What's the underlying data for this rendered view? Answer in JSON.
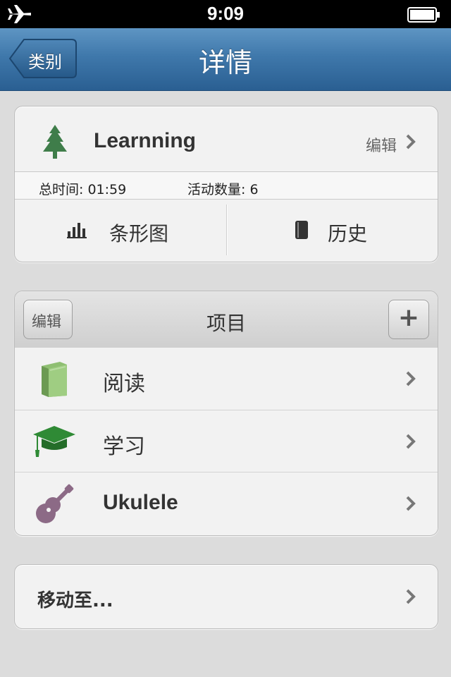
{
  "status_bar": {
    "time": "9:09",
    "left_icon": "airplane-icon",
    "right_icon": "battery-icon"
  },
  "nav": {
    "back_label": "类别",
    "title": "详情"
  },
  "category_card": {
    "name": "Learnning",
    "icon": "tree-icon",
    "edit_label": "编辑",
    "total_time_label": "总时间: 01:59",
    "activity_count_label": "活动数量: 6",
    "tabs": [
      {
        "label": "条形图",
        "icon": "bar-chart-icon"
      },
      {
        "label": "历史",
        "icon": "notebook-icon"
      }
    ]
  },
  "projects": {
    "edit_label": "编辑",
    "title": "项目",
    "add_label": "+",
    "items": [
      {
        "label": "阅读",
        "icon": "book-icon"
      },
      {
        "label": "学习",
        "icon": "graduation-cap-icon"
      },
      {
        "label": "Ukulele",
        "icon": "ukulele-icon"
      }
    ]
  },
  "move": {
    "label": "移动至..."
  },
  "colors": {
    "nav_blue": "#3f78ab",
    "tree_green": "#3f7d4a",
    "book_green": "#8fbf72",
    "cap_green": "#2f8a35",
    "ukulele_purple": "#8c6a86"
  }
}
